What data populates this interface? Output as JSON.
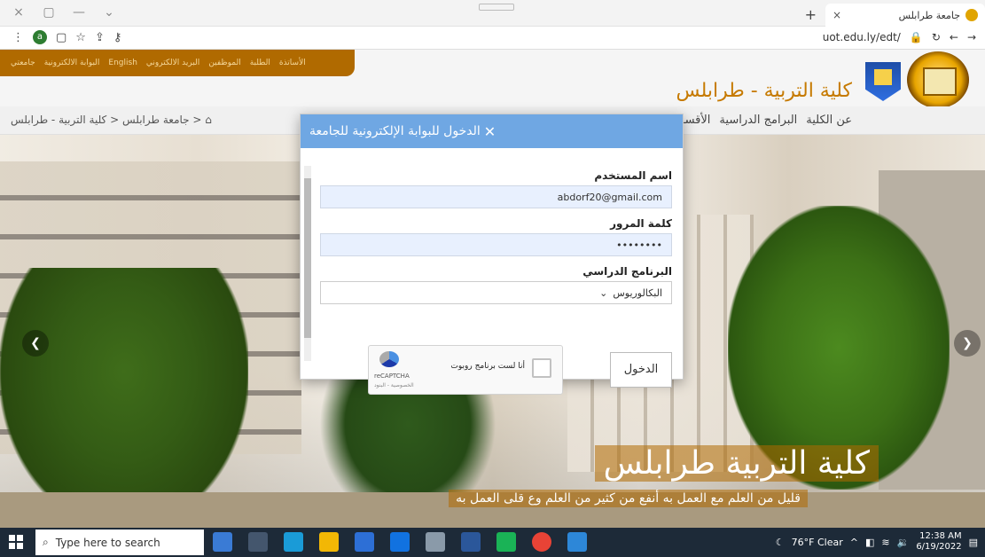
{
  "browser": {
    "tab_title": "جامعة طرابلس",
    "tab_close": "×",
    "new_tab": "+",
    "url": "uot.edu.ly/edt/",
    "profile_letter": "a",
    "window_controls": [
      "×",
      "▢",
      "—",
      "⌄"
    ]
  },
  "site": {
    "topnav": [
      "الأساتذة",
      "الطلبة",
      "الموظفين",
      "البريد الالكتروني",
      "English",
      "البوابة الالكترونية",
      "جامعتي"
    ],
    "title": "كلية التربية - طرابلس",
    "breadcrumb": "⌂ < جامعة طرابلس < كلية التربية - طرابلس",
    "mainnav": [
      "عن الكلية",
      "البرامج الدراسية",
      "الأقسـ"
    ],
    "hero_title": "كلية التربية طرابلس",
    "hero_subtitle": "قليل من العلم مع العمل به أنفع من كثير من العلم وع قلى العمل به"
  },
  "modal": {
    "title": "الدخول للبوابة الإلكترونية للجامعة",
    "close": "✕",
    "username_label": "اسم المستخدم",
    "username_value": "abdorf20@gmail.com",
    "password_label": "كلمة المرور",
    "password_value": "••••••••",
    "program_label": "البرنامج الدراسي",
    "program_value": "البكالوريوس",
    "login_button": "الدخول",
    "captcha_label": "أنا لست برنامج روبوت",
    "captcha_brand": "reCAPTCHA",
    "captcha_terms": "الخصوصية - البنود"
  },
  "taskbar": {
    "search_placeholder": "Type here to search",
    "weather": "76°F Clear",
    "time": "12:38 AM",
    "date": "6/19/2022"
  }
}
